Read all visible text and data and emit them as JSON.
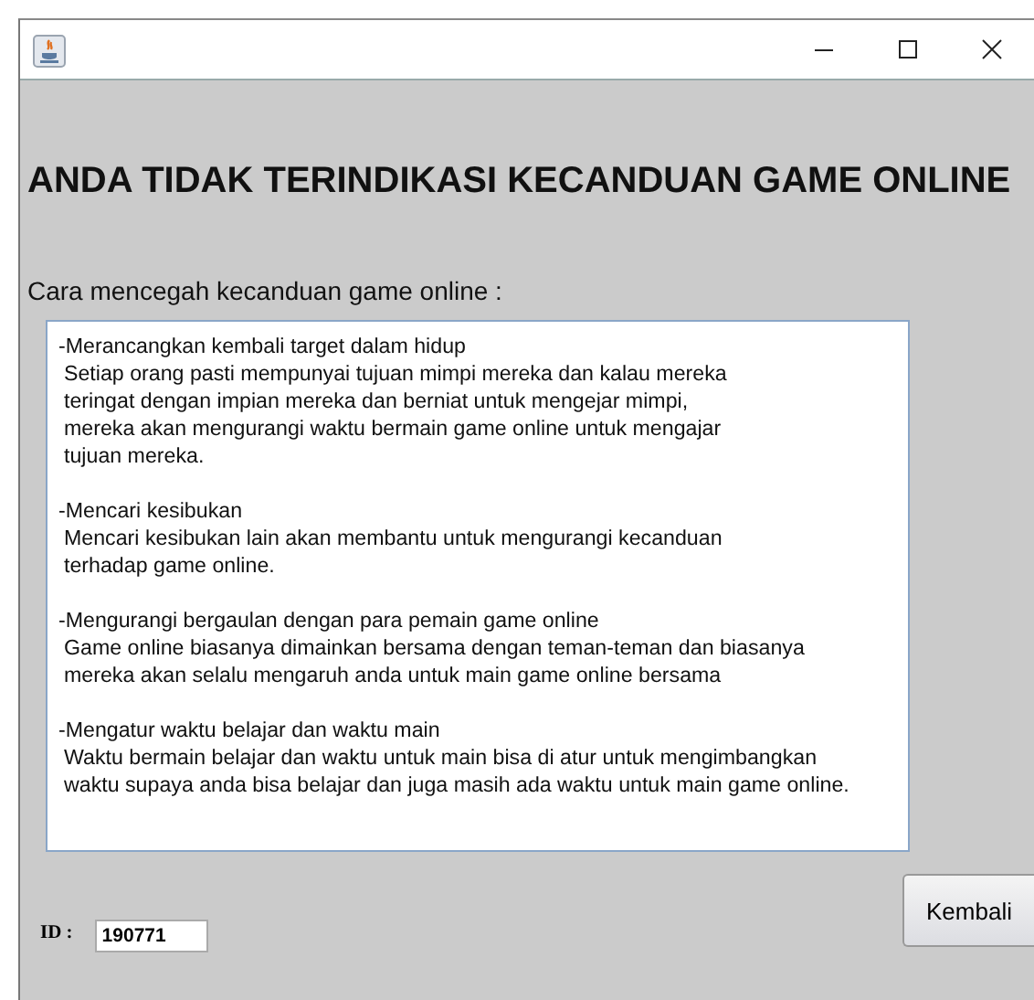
{
  "window": {
    "title_buttons": [
      {
        "kind": "minimize"
      },
      {
        "kind": "maximize"
      },
      {
        "kind": "close"
      }
    ]
  },
  "heading": "ANDA TIDAK TERINDIKASI KECANDUAN GAME ONLINE",
  "prompt": "Cara mencegah kecanduan game online :",
  "text_area": {
    "paragraphs": [
      {
        "heading": "-Merancangkan kembali target dalam hidup",
        "lines": [
          "Setiap orang pasti mempunyai tujuan mimpi mereka dan kalau mereka",
          "teringat dengan impian mereka dan berniat untuk mengejar mimpi,",
          "mereka akan mengurangi waktu bermain game online untuk mengajar",
          "tujuan mereka."
        ]
      },
      {
        "heading": "-Mencari kesibukan",
        "lines": [
          "Mencari kesibukan lain akan membantu untuk mengurangi kecanduan",
          "terhadap game online."
        ]
      },
      {
        "heading": "-Mengurangi bergaulan dengan para pemain game online",
        "lines": [
          "Game online biasanya dimainkan bersama dengan teman-teman dan biasanya",
          "mereka akan selalu mengaruh anda untuk main game online bersama"
        ]
      },
      {
        "heading": "-Mengatur waktu belajar dan waktu main",
        "lines": [
          "Waktu bermain belajar dan waktu untuk main bisa di atur untuk mengimbangkan",
          "waktu supaya anda bisa belajar dan juga masih ada waktu untuk main game online."
        ]
      }
    ]
  },
  "id_label": "ID :",
  "id_value": "190771",
  "button": "Kembali"
}
